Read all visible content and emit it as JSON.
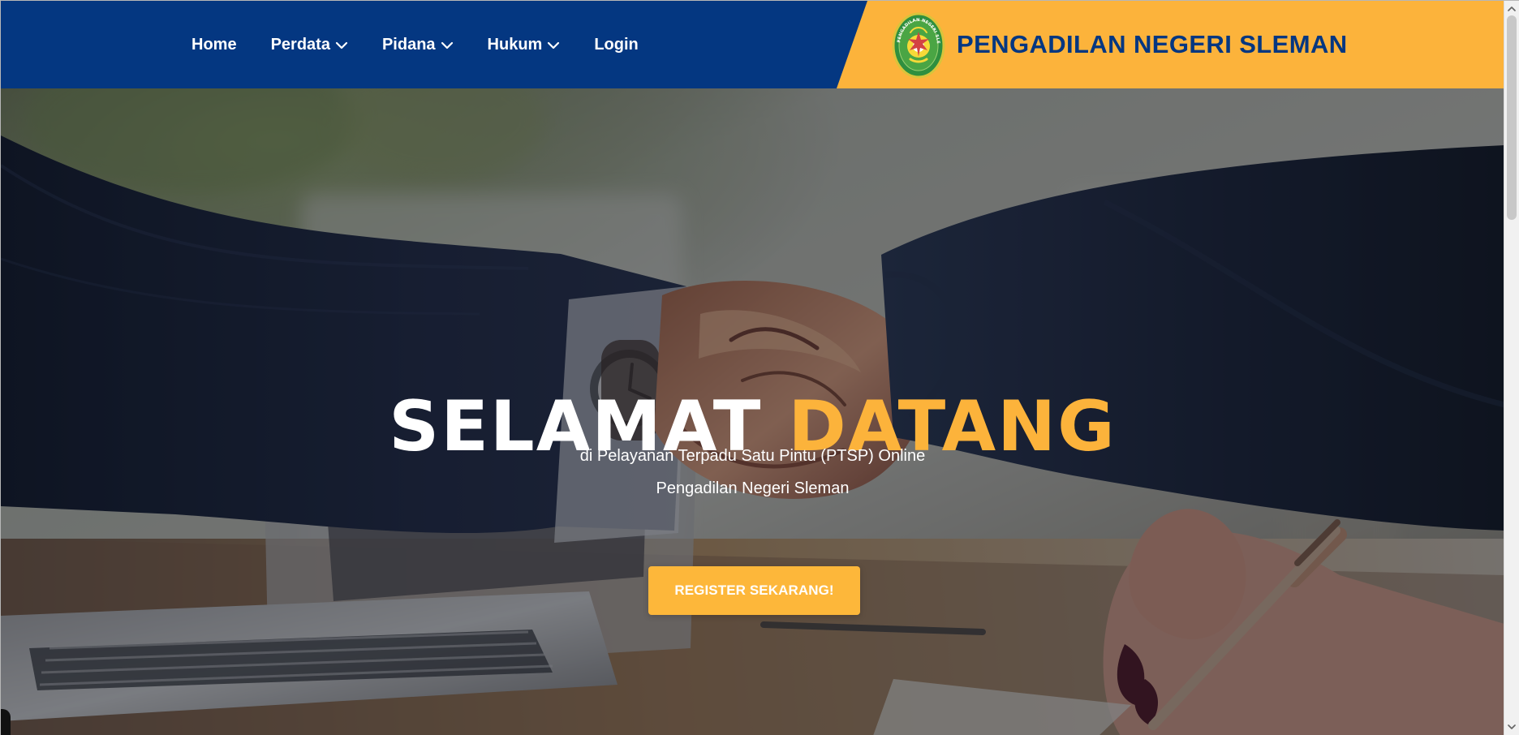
{
  "navigation": {
    "items": [
      {
        "label": "Home",
        "has_dropdown": false
      },
      {
        "label": "Perdata",
        "has_dropdown": true
      },
      {
        "label": "Pidana",
        "has_dropdown": true
      },
      {
        "label": "Hukum",
        "has_dropdown": true
      },
      {
        "label": "Login",
        "has_dropdown": false
      }
    ]
  },
  "brand": {
    "title": "PENGADILAN NEGERI SLEMAN",
    "logo": {
      "icon": "court-emblem-icon",
      "text": "PENGADILAN NEGERI SLEMAN"
    }
  },
  "hero": {
    "title_first": "SELAMAT",
    "title_second": "DATANG",
    "subtitle_line_1": "di Pelayanan Terpadu Satu Pintu (PTSP) Online",
    "subtitle_line_2": "Pengadilan Negeri Sleman",
    "button_label": "REGISTER SEKARANG!",
    "background_icon": "business-handshake-photo"
  },
  "colors": {
    "navy": "#043781",
    "gold": "#fcb33b",
    "white": "#ffffff"
  }
}
